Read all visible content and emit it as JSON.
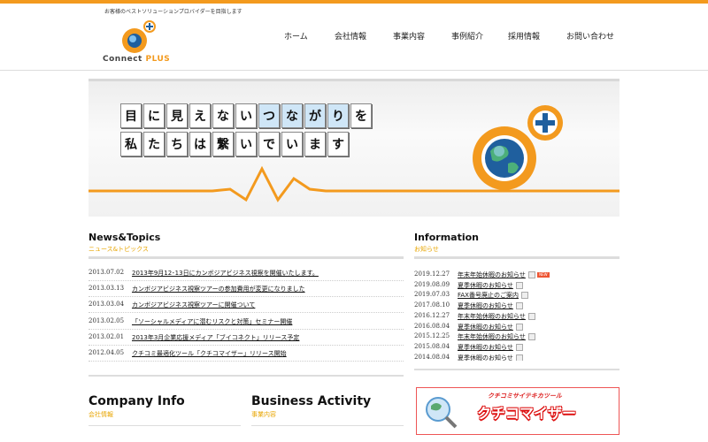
{
  "header": {
    "tagline": "お客様のベストソリューションプロバイダーを目指します",
    "logo_main": "Connect",
    "logo_accent": "PLUS",
    "nav": [
      "ホーム",
      "会社情報",
      "事業内容",
      "事例紹介",
      "採用情報",
      "お問い合わせ"
    ]
  },
  "hero": {
    "row1": [
      "目",
      "に",
      "見",
      "え",
      "な",
      "い",
      "つ",
      "な",
      "が",
      "り",
      "を"
    ],
    "row1_highlight": [
      false,
      false,
      false,
      false,
      false,
      false,
      true,
      true,
      true,
      true,
      false
    ],
    "row2": [
      "私",
      "た",
      "ち",
      "は",
      "繋",
      "い",
      "で",
      "い",
      "ま",
      "す"
    ]
  },
  "news": {
    "title": "News&Topics",
    "subtitle": "ニュース&トピックス",
    "items": [
      {
        "date": "2013.07.02",
        "text": "2013年9月12･13日にカンボジアビジネス視察を開催いたします。"
      },
      {
        "date": "2013.03.13",
        "text": "カンボジアビジネス視察ツアーの参加費用が変更になりました"
      },
      {
        "date": "2013.03.04",
        "text": "カンボジアビジネス視察ツアーに開催ついて"
      },
      {
        "date": "2013.02.05",
        "text": "「ソーシャルメディアに潜むリスクと対策」セミナー開催"
      },
      {
        "date": "2013.02.01",
        "text": "2013年3月企業応援メディア「ブイコネクト」リリース予定"
      },
      {
        "date": "2012.04.05",
        "text": "クチコミ最適化ツール「クチコマイザー」リリース開始"
      }
    ]
  },
  "info": {
    "title": "Information",
    "subtitle": "お知らせ",
    "new_label": "NEW",
    "items": [
      {
        "date": "2019.12.27",
        "text": "年末年始休暇のお知らせ",
        "is_new": true
      },
      {
        "date": "2019.08.09",
        "text": "夏季休暇のお知らせ",
        "is_new": false
      },
      {
        "date": "2019.07.03",
        "text": "FAX番号廃止のご案内",
        "is_new": false
      },
      {
        "date": "2017.08.10",
        "text": "夏季休暇のお知らせ",
        "is_new": false
      },
      {
        "date": "2016.12.27",
        "text": "年末年始休暇のお知らせ",
        "is_new": false
      },
      {
        "date": "2016.08.04",
        "text": "夏季休暇のお知らせ",
        "is_new": false
      },
      {
        "date": "2015.12.25",
        "text": "年末年始休暇のお知らせ",
        "is_new": false
      },
      {
        "date": "2015.08.04",
        "text": "夏季休暇のお知らせ",
        "is_new": false
      },
      {
        "date": "2014.08.04",
        "text": "夏季休暇のお知らせ",
        "is_new": false
      }
    ]
  },
  "company": {
    "title": "Company Info",
    "subtitle": "会社情報"
  },
  "business": {
    "title": "Business Activity",
    "subtitle": "事業内容"
  },
  "banner": {
    "top_text": "クチコミサイテキカツール",
    "main_text": "クチコマイザー"
  },
  "colors": {
    "accent": "#f39a1e",
    "subtitle": "#e8a500",
    "banner_red": "#dd1111",
    "highlight_tile": "#cfe6f7"
  }
}
